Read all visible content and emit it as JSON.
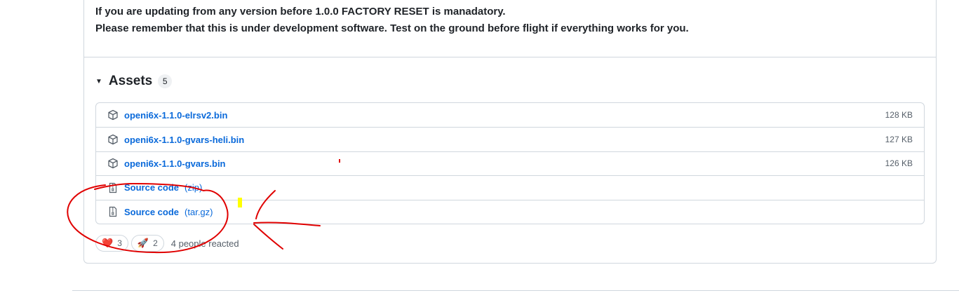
{
  "release_notes": {
    "line1": "If you are updating from any version before 1.0.0 FACTORY RESET is manadatory.",
    "line2": "Please remember that this is under development software. Test on the ground before flight if everything works for you."
  },
  "assets": {
    "title": "Assets",
    "count": "5",
    "items": [
      {
        "name": "openi6x-1.1.0-elrsv2.bin",
        "size": "128 KB",
        "icon": "package-icon"
      },
      {
        "name": "openi6x-1.1.0-gvars-heli.bin",
        "size": "127 KB",
        "icon": "package-icon"
      },
      {
        "name": "openi6x-1.1.0-gvars.bin",
        "size": "126 KB",
        "icon": "package-icon"
      },
      {
        "name": "Source code",
        "ext": "(zip)",
        "icon": "file-zip-icon"
      },
      {
        "name": "Source code",
        "ext": "(tar.gz)",
        "icon": "file-zip-icon"
      }
    ]
  },
  "reactions": {
    "items": [
      {
        "emoji": "❤️",
        "count": "3",
        "icon": "heart-icon"
      },
      {
        "emoji": "🚀",
        "count": "2",
        "icon": "rocket-icon"
      }
    ],
    "summary": "4 people reacted"
  },
  "annotation_colors": {
    "red_marker": "#e00000",
    "yellow_highlight": "#ffff00"
  }
}
